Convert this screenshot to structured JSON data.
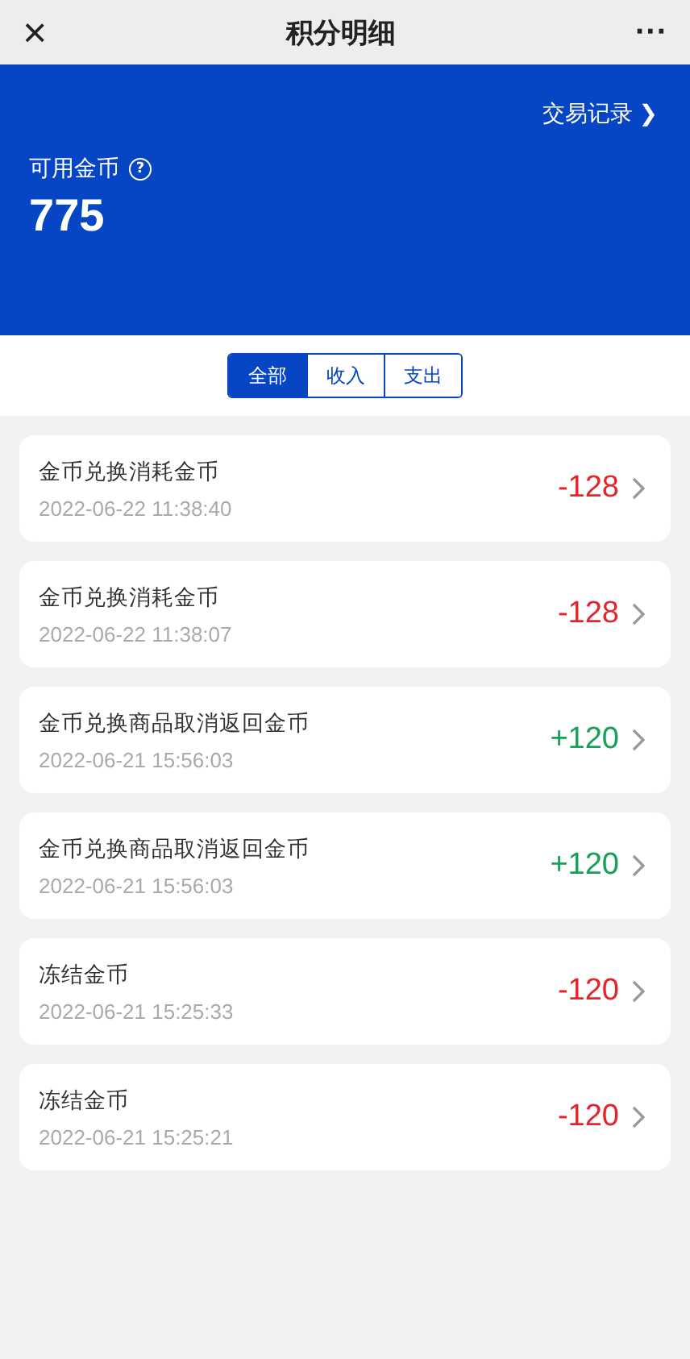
{
  "nav": {
    "close": "×",
    "title": "积分明细",
    "more": "···"
  },
  "balance": {
    "link": "交易记录",
    "link_arrow": "❯",
    "label": "可用金币",
    "help": "?",
    "value": "775"
  },
  "tabs": [
    {
      "label": "全部",
      "selected": true
    },
    {
      "label": "收入",
      "selected": false
    },
    {
      "label": "支出",
      "selected": false
    }
  ],
  "records": [
    {
      "title": "金币兑换消耗金币",
      "time": "2022-06-22 11:38:40",
      "amount": "-128",
      "kind": "expense"
    },
    {
      "title": "金币兑换消耗金币",
      "time": "2022-06-22 11:38:07",
      "amount": "-128",
      "kind": "expense"
    },
    {
      "title": "金币兑换商品取消返回金币",
      "time": "2022-06-21 15:56:03",
      "amount": "+120",
      "kind": "income"
    },
    {
      "title": "金币兑换商品取消返回金币",
      "time": "2022-06-21 15:56:03",
      "amount": "+120",
      "kind": "income"
    },
    {
      "title": "冻结金币",
      "time": "2022-06-21 15:25:33",
      "amount": "-120",
      "kind": "expense"
    },
    {
      "title": "冻结金币",
      "time": "2022-06-21 15:25:21",
      "amount": "-120",
      "kind": "expense"
    }
  ]
}
